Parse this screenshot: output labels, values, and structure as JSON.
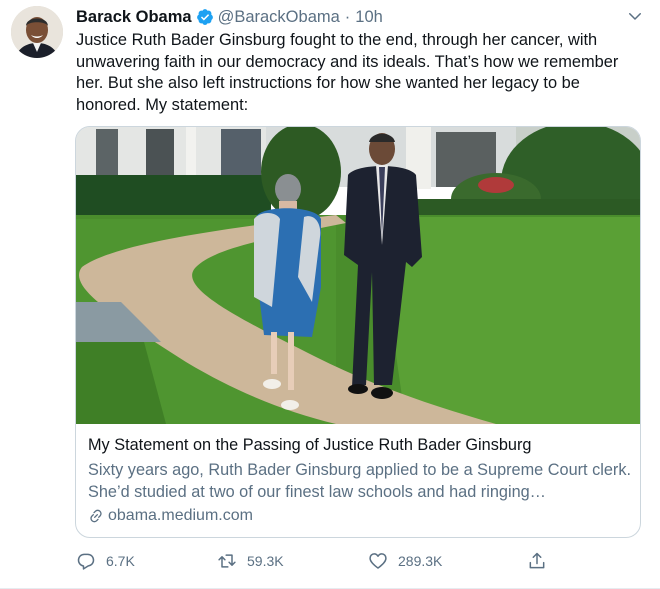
{
  "tweet": {
    "author_name": "Barack Obama",
    "handle": "@BarackObama",
    "separator": "·",
    "time": "10h",
    "text": "Justice Ruth Bader Ginsburg fought to the end, through her cancer, with unwavering faith in our democracy and its ideals. That’s how we remember her. But she also left instructions for how she wanted her legacy to be honored. My statement:",
    "verified_icon": "verified-badge-icon",
    "menu_icon": "chevron-down-icon"
  },
  "card": {
    "title": "My Statement on the Passing of Justice Ruth Bader Ginsburg",
    "description": "Sixty years ago, Ruth Bader Ginsburg applied to be a Supreme Court clerk. She’d studied at two of our finest law schools and had ringing…",
    "domain": "obama.medium.com",
    "link_icon": "link-icon"
  },
  "actions": {
    "reply_count": "6.7K",
    "retweet_count": "59.3K",
    "like_count": "289.3K",
    "reply_icon": "reply-icon",
    "retweet_icon": "retweet-icon",
    "like_icon": "heart-icon",
    "share_icon": "share-icon"
  },
  "colors": {
    "accent": "#1da1f2",
    "secondary_text": "#5b7083",
    "border": "#ccd6dd"
  }
}
